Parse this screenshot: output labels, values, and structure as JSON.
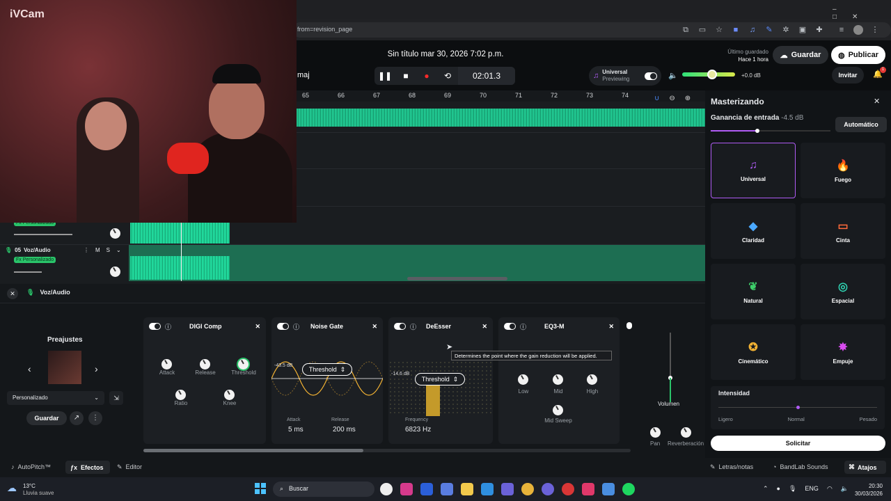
{
  "browser": {
    "url": "from=revision_page"
  },
  "overlay": {
    "ivcam": "iVCam"
  },
  "header": {
    "title": "Sin título mar 30, 2026 7:02 p.m.",
    "left_label": "maj",
    "time": "02:01.3",
    "preset_name": "Universal",
    "preset_sub": "Previewing",
    "volume": "+0.0 dB",
    "last_saved_label": "Último guardado",
    "last_saved_time": "Hace 1 hora",
    "save": "Guardar",
    "publish": "Publicar",
    "invite": "Invitar",
    "notif_count": "1"
  },
  "ruler": {
    "ticks": [
      "65",
      "66",
      "67",
      "68",
      "69",
      "70",
      "71",
      "72",
      "73",
      "74"
    ]
  },
  "tracks": [
    {
      "fx_badge": "Fx Personalizado"
    },
    {
      "number": "05",
      "name": "Voz/Audio",
      "m": "M",
      "s": "S",
      "fx_badge": "Fx Personalizado"
    }
  ],
  "fx_panel": {
    "track_name": "Voz/Audio"
  },
  "presets": {
    "title": "Preajustes",
    "selected": "Personalizado",
    "save": "Guardar"
  },
  "effects": [
    {
      "name": "DIGI Comp",
      "knobs": [
        "Attack",
        "Release",
        "Threshold",
        "Ratio",
        "Knee"
      ]
    },
    {
      "name": "Noise Gate",
      "db": "-43.5 dB",
      "param": "Threshold",
      "attack_label": "Attack",
      "attack_value": "5 ms",
      "release_label": "Release",
      "release_value": "200 ms"
    },
    {
      "name": "DeEsser",
      "db": "-14.6 dB",
      "param": "Threshold",
      "freq_label": "Frequency",
      "freq_value": "6823 Hz",
      "tooltip": "Determines the point where the gain reduction will be applied."
    },
    {
      "name": "EQ3-M",
      "knobs": [
        "Low",
        "Mid",
        "High",
        "Mid Sweep"
      ]
    }
  ],
  "mixer": {
    "volume": "Volumen",
    "pan": "Pan",
    "reverb": "Reverberación"
  },
  "mastering": {
    "title": "Masterizando",
    "gain_label": "Ganancia de entrada",
    "gain_value": "-4.5 dB",
    "auto": "Automático",
    "tiles": [
      {
        "name": "Universal",
        "icon": "music-note-icon",
        "color": "#b05cf5"
      },
      {
        "name": "Fuego",
        "icon": "flame-icon",
        "color": "#ff4d3a"
      },
      {
        "name": "Claridad",
        "icon": "diamond-icon",
        "color": "#4aa9ff"
      },
      {
        "name": "Cinta",
        "icon": "tape-icon",
        "color": "#ff6a3a"
      },
      {
        "name": "Natural",
        "icon": "leaf-icon",
        "color": "#3ecf6a"
      },
      {
        "name": "Espacial",
        "icon": "spiral-icon",
        "color": "#2fd1b0"
      },
      {
        "name": "Cinemático",
        "icon": "film-reel-icon",
        "color": "#f2b233"
      },
      {
        "name": "Empuje",
        "icon": "burst-icon",
        "color": "#d94cf0"
      }
    ],
    "intensity_label": "Intensidad",
    "levels": [
      "Ligero",
      "Normal",
      "Pesado"
    ],
    "request": "Solicitar"
  },
  "bottom": {
    "autopitch": "AutoPitch™",
    "effects": "Efectos",
    "editor": "Editor",
    "lyrics": "Letras/notas",
    "sounds": "BandLab Sounds",
    "shortcuts": "Atajos"
  },
  "taskbar": {
    "temp": "13°C",
    "weather": "Lluvia suave",
    "search": "Buscar",
    "lang": "ENG",
    "time": "20:30",
    "date": "30/03/2026"
  }
}
